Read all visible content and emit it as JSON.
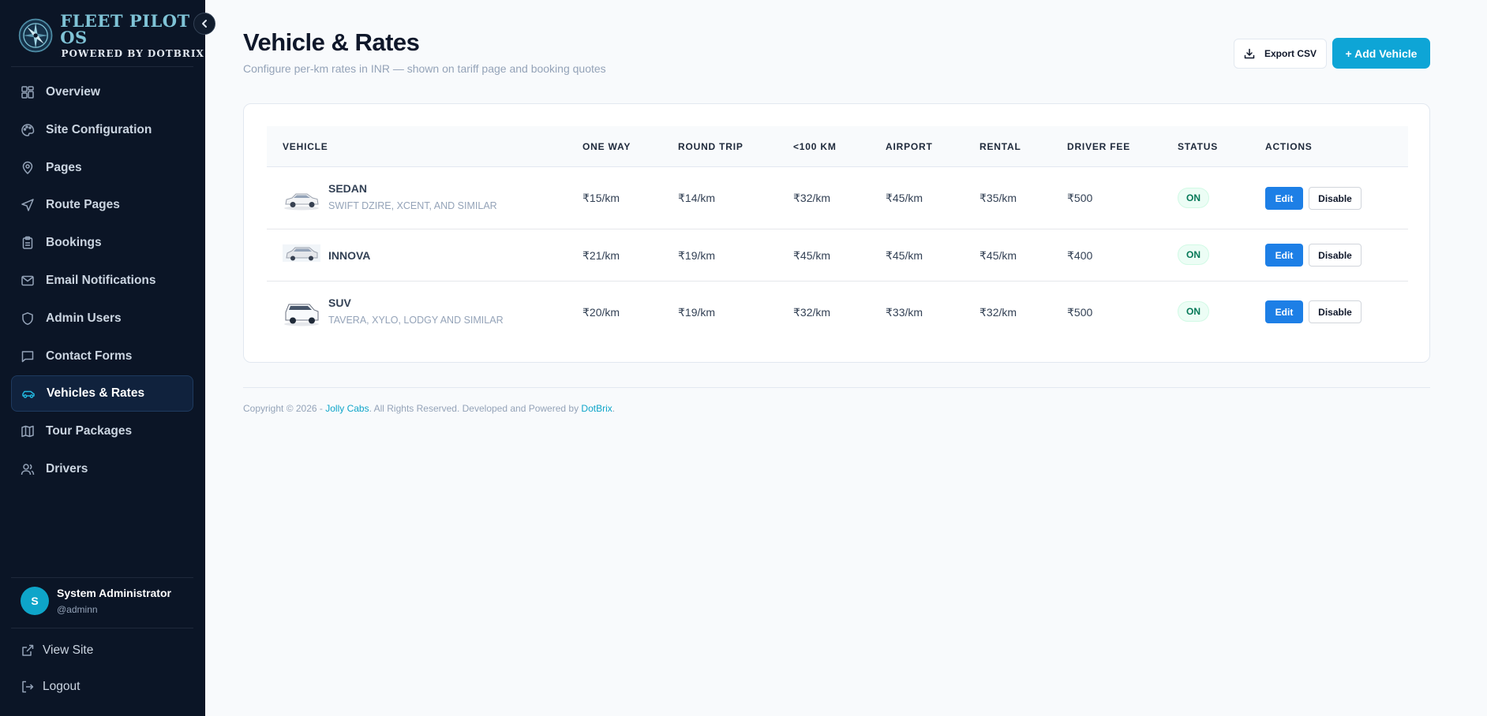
{
  "brand": {
    "title": "FLEET PILOT OS",
    "subtitle": "POWERED BY DOTBRIX"
  },
  "sidebar": {
    "items": [
      {
        "label": "Overview",
        "icon": "grid-icon"
      },
      {
        "label": "Site Configuration",
        "icon": "palette-icon"
      },
      {
        "label": "Pages",
        "icon": "map-pin-icon"
      },
      {
        "label": "Route Pages",
        "icon": "navigation-icon"
      },
      {
        "label": "Bookings",
        "icon": "clipboard-icon"
      },
      {
        "label": "Email Notifications",
        "icon": "mail-icon"
      },
      {
        "label": "Admin Users",
        "icon": "shield-icon"
      },
      {
        "label": "Contact Forms",
        "icon": "message-icon"
      },
      {
        "label": "Vehicles & Rates",
        "icon": "car-icon",
        "active": true
      },
      {
        "label": "Tour Packages",
        "icon": "map-icon"
      },
      {
        "label": "Drivers",
        "icon": "users-icon"
      }
    ],
    "user": {
      "initial": "S",
      "name": "System Administrator",
      "handle": "@adminn"
    },
    "view_site": "View Site",
    "logout": "Logout"
  },
  "header": {
    "title": "Vehicle & Rates",
    "subtitle": "Configure per-km rates in INR — shown on tariff page and booking quotes",
    "export_label": "Export CSV",
    "add_label": "+ Add Vehicle"
  },
  "table": {
    "columns": [
      "VEHICLE",
      "ONE WAY",
      "ROUND TRIP",
      "<100 KM",
      "AIRPORT",
      "RENTAL",
      "DRIVER FEE",
      "STATUS",
      "ACTIONS"
    ],
    "rows": [
      {
        "name": "SEDAN",
        "desc": "SWIFT DZIRE, XCENT, AND SIMILAR",
        "one_way": "₹15/km",
        "round_trip": "₹14/km",
        "under_100": "₹32/km",
        "airport": "₹45/km",
        "rental": "₹35/km",
        "driver_fee": "₹500",
        "status": "ON",
        "edit": "Edit",
        "disable": "Disable"
      },
      {
        "name": "INNOVA",
        "desc": "",
        "one_way": "₹21/km",
        "round_trip": "₹19/km",
        "under_100": "₹45/km",
        "airport": "₹45/km",
        "rental": "₹45/km",
        "driver_fee": "₹400",
        "status": "ON",
        "edit": "Edit",
        "disable": "Disable"
      },
      {
        "name": "SUV",
        "desc": "TAVERA, XYLO, LODGY AND SIMILAR",
        "one_way": "₹20/km",
        "round_trip": "₹19/km",
        "under_100": "₹32/km",
        "airport": "₹33/km",
        "rental": "₹32/km",
        "driver_fee": "₹500",
        "status": "ON",
        "edit": "Edit",
        "disable": "Disable"
      }
    ]
  },
  "footer": {
    "prefix": "Copyright © 2026 - ",
    "company": "Jolly Cabs",
    "middle": ". All Rights Reserved. Developed and Powered by ",
    "developer": "DotBrix",
    "suffix": "."
  },
  "colors": {
    "sidebar_bg": "#0b1526",
    "accent": "#0ea5d6",
    "edit_button": "#1d7fe6",
    "status_on": "#047857"
  }
}
